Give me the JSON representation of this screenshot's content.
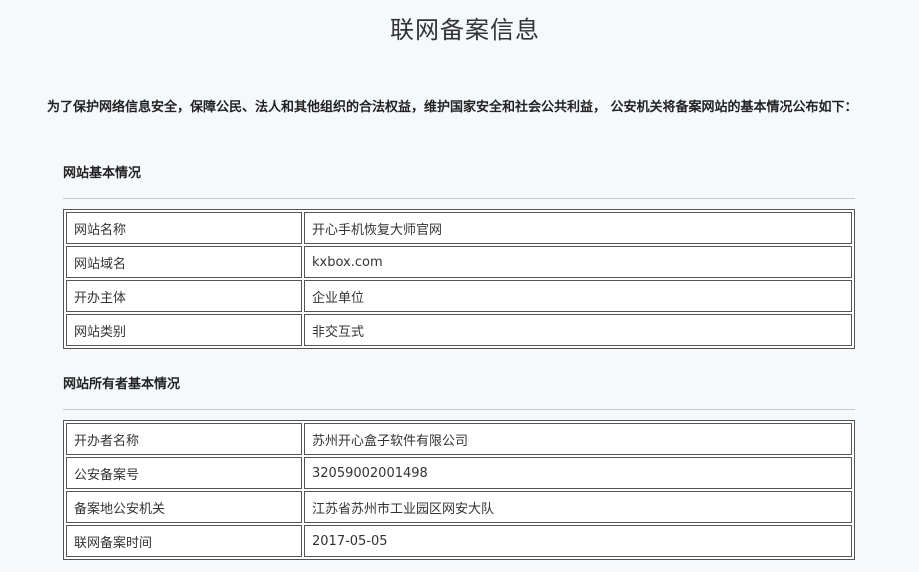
{
  "page": {
    "title": "联网备案信息",
    "intro": "为了保护网络信息安全，保障公民、法人和其他组织的合法权益，维护国家安全和社会公共利益， 公安机关将备案网站的基本情况公布如下："
  },
  "website_section": {
    "title": "网站基本情况",
    "rows": [
      {
        "label": "网站名称",
        "value": "开心手机恢复大师官网"
      },
      {
        "label": "网站域名",
        "value": "kxbox.com"
      },
      {
        "label": "开办主体",
        "value": "企业单位"
      },
      {
        "label": "网站类别",
        "value": "非交互式"
      }
    ]
  },
  "owner_section": {
    "title": "网站所有者基本情况",
    "rows": [
      {
        "label": "开办者名称",
        "value": "苏州开心盒子软件有限公司"
      },
      {
        "label": "公安备案号",
        "value": "32059002001498"
      },
      {
        "label": "备案地公安机关",
        "value": "江苏省苏州市工业园区网安大队"
      },
      {
        "label": "联网备案时间",
        "value": "2017-05-05"
      }
    ]
  }
}
